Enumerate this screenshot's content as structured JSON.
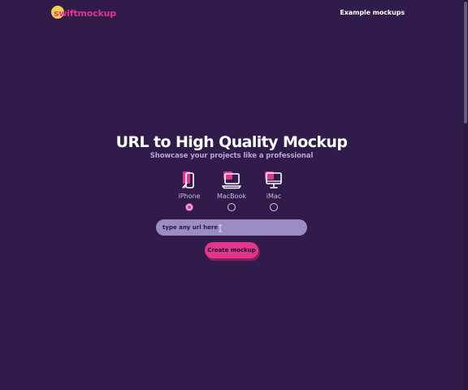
{
  "header": {
    "logo_text": "swiftmockup",
    "nav_link": "Example mockups"
  },
  "hero": {
    "title": "URL to High Quality Mockup",
    "subtitle": "Showcase your projects like a professional"
  },
  "devices": [
    {
      "label": "iPhone",
      "icon": "iphone-icon",
      "selected": true
    },
    {
      "label": "MacBook",
      "icon": "macbook-icon",
      "selected": false
    },
    {
      "label": "iMac",
      "icon": "imac-icon",
      "selected": false
    }
  ],
  "url_input": {
    "placeholder": "type any url here",
    "value": ""
  },
  "create_button": {
    "label": "Create mockup"
  },
  "colors": {
    "background": "#301b4b",
    "accent_pink": "#e0368e",
    "logo_yellow": "#f2d14c",
    "input_bg": "#9c8cc4",
    "subtitle": "#b8a6d4"
  }
}
